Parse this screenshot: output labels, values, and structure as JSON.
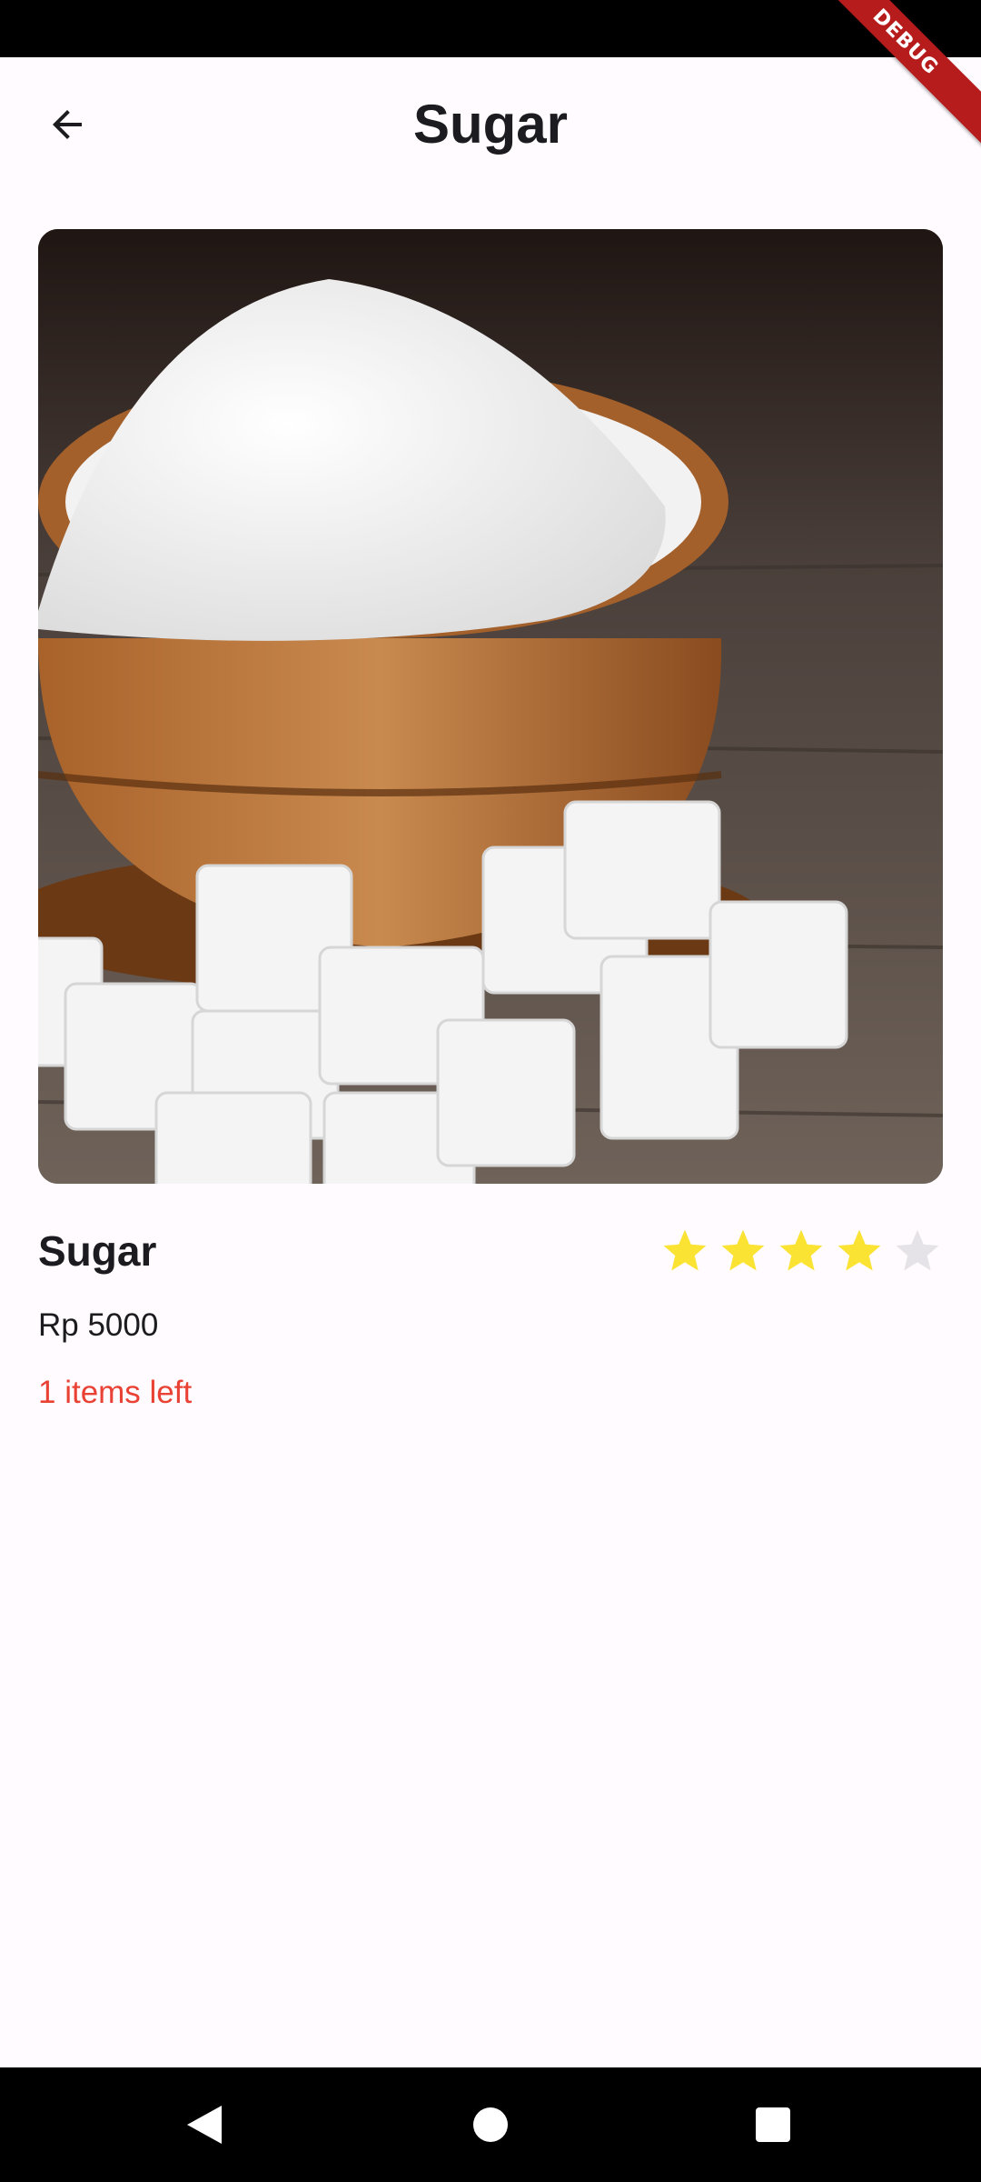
{
  "app_bar": {
    "title": "Sugar",
    "back_icon": "arrow-back-icon"
  },
  "debug_banner": "DEBUG",
  "product": {
    "image_alt": "Sugar in a wooden bowl with sugar cubes",
    "name": "Sugar",
    "price": "Rp 5000",
    "stock": "1 items left",
    "rating": 4,
    "rating_max": 5
  },
  "colors": {
    "background": "#fffbfe",
    "star_filled": "#fbe334",
    "star_empty": "#e6e3e8",
    "stock_text": "#e94235"
  },
  "nav": {
    "back_icon": "triangle-back-icon",
    "home_icon": "circle-home-icon",
    "recents_icon": "square-recents-icon"
  }
}
